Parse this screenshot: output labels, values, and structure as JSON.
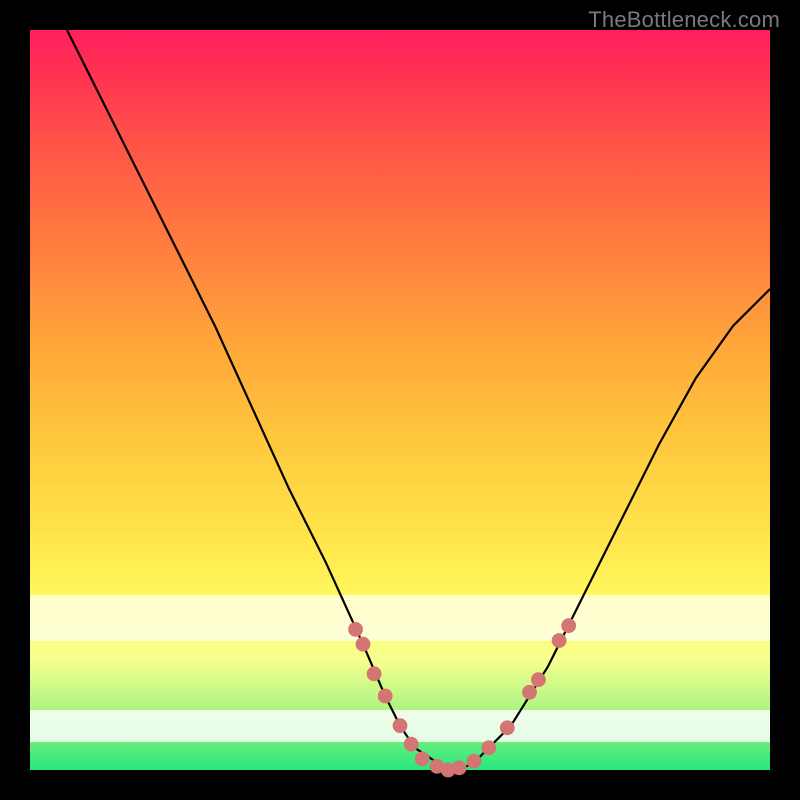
{
  "watermark": "TheBottleneck.com",
  "chart_data": {
    "type": "line",
    "title": "",
    "xlabel": "",
    "ylabel": "",
    "xlim": [
      0,
      100
    ],
    "ylim": [
      0,
      100
    ],
    "grid": false,
    "series": [
      {
        "name": "curve",
        "x": [
          5,
          10,
          15,
          20,
          25,
          30,
          35,
          40,
          45,
          48,
          50,
          52,
          55,
          56,
          58,
          60,
          65,
          70,
          75,
          80,
          85,
          90,
          95,
          100
        ],
        "values": [
          100,
          90,
          80,
          70,
          60,
          49,
          38,
          28,
          17,
          10,
          6,
          3,
          1,
          0,
          0,
          1,
          6,
          14,
          24,
          34,
          44,
          53,
          60,
          65
        ],
        "color": "#000000"
      }
    ],
    "markers": {
      "color": "#d37572",
      "radius_pct": 1.0,
      "points": [
        {
          "x": 44,
          "y": 19
        },
        {
          "x": 45,
          "y": 17
        },
        {
          "x": 46.5,
          "y": 13
        },
        {
          "x": 48,
          "y": 10
        },
        {
          "x": 50,
          "y": 6
        },
        {
          "x": 51.5,
          "y": 3.5
        },
        {
          "x": 53,
          "y": 1.5
        },
        {
          "x": 55,
          "y": 0.5
        },
        {
          "x": 56.5,
          "y": 0
        },
        {
          "x": 58,
          "y": 0.3
        },
        {
          "x": 60,
          "y": 1.2
        },
        {
          "x": 62,
          "y": 3
        },
        {
          "x": 64.5,
          "y": 5.7
        },
        {
          "x": 67.5,
          "y": 10.5
        },
        {
          "x": 68.7,
          "y": 12.2
        },
        {
          "x": 71.5,
          "y": 17.5
        },
        {
          "x": 72.8,
          "y": 19.5
        }
      ]
    },
    "bands": [
      {
        "name": "pale-yellow",
        "y_from": 17,
        "y_to": 24,
        "rgba": [
          255,
          255,
          240,
          0.7
        ]
      },
      {
        "name": "near-white",
        "y_from": 1,
        "y_to": 5,
        "rgba": [
          255,
          255,
          255,
          0.8
        ]
      }
    ]
  }
}
